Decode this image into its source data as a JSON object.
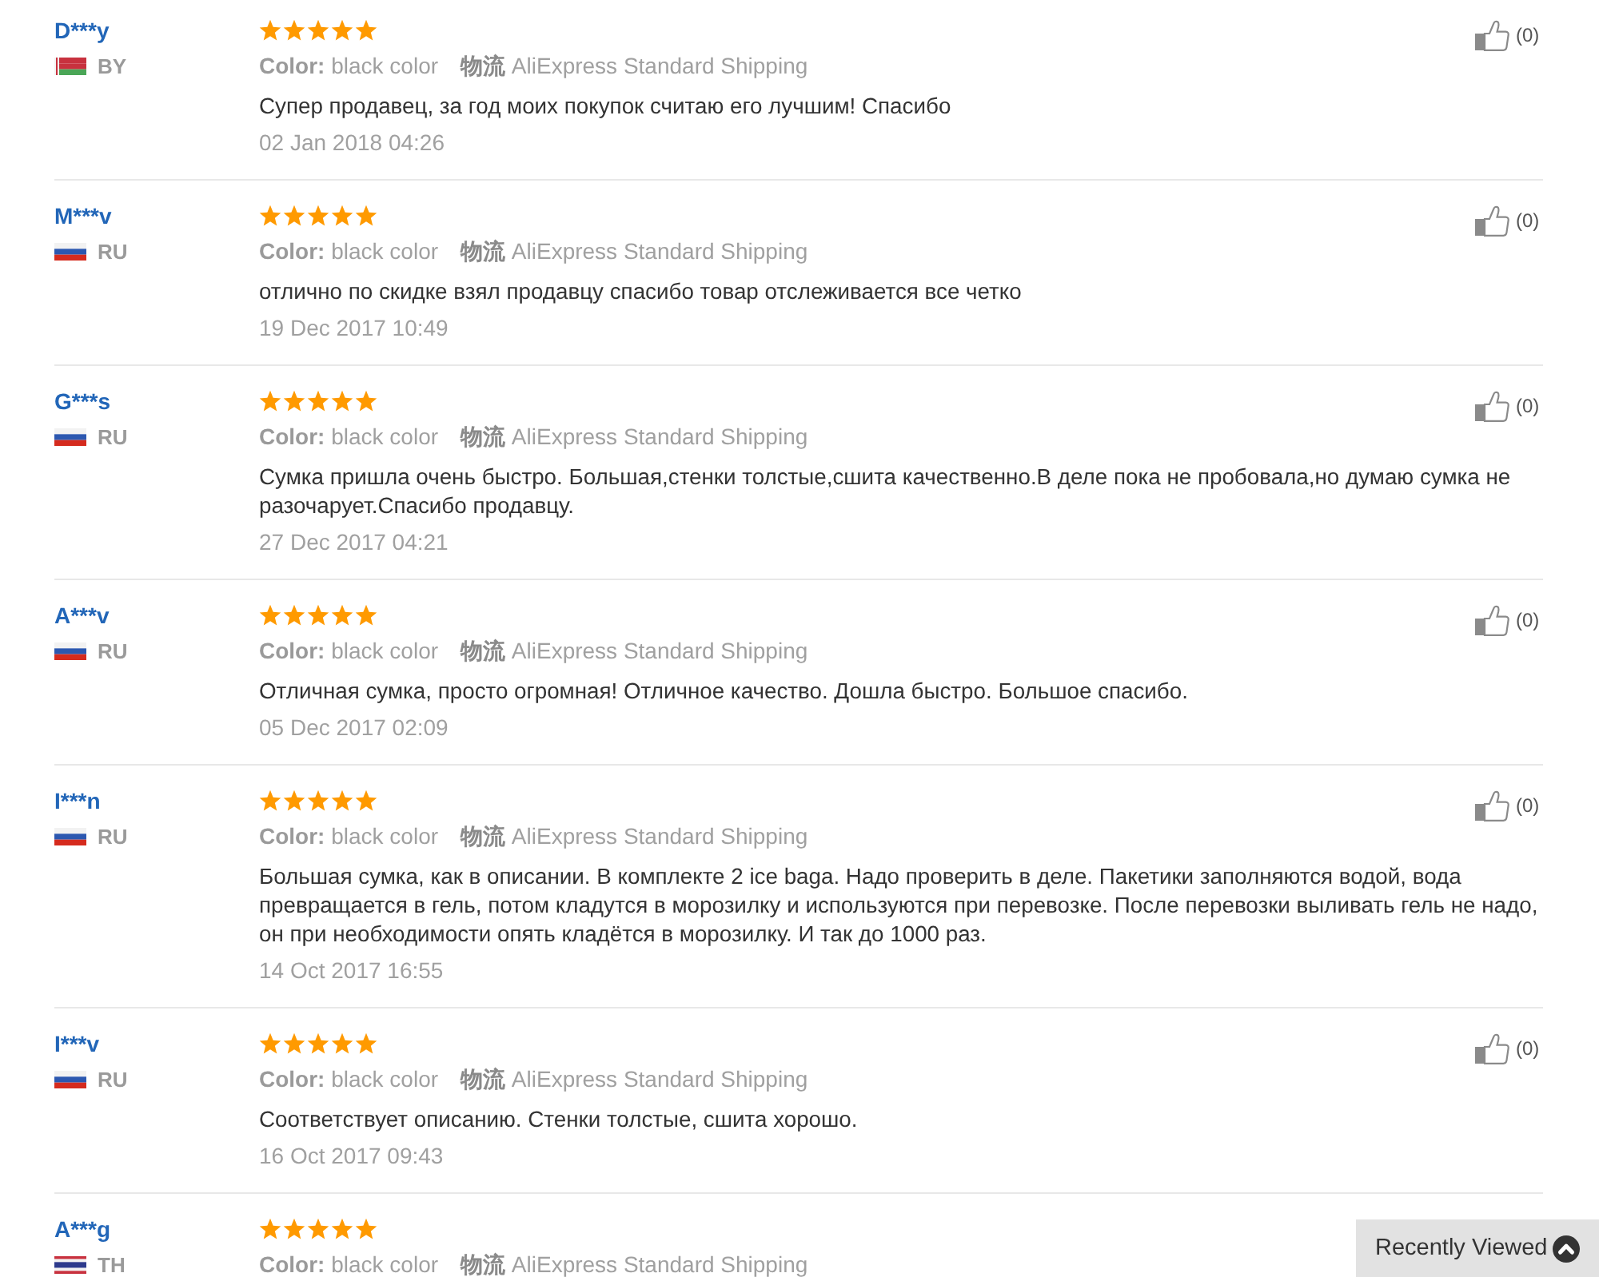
{
  "reviews": [
    {
      "name": "D***y",
      "country": "BY",
      "flag": {
        "kind": "belarus"
      },
      "stars": 5,
      "variant": "**Color:** black color",
      "shipping": "**物流** AliExpress Standard Shipping",
      "text": "Супер продавец, за год моих покупок считаю его лучшим! Спасибо",
      "date": "02 Jan 2018 04:26",
      "likes": "(0)"
    },
    {
      "name": "M***v",
      "country": "RU",
      "flag": {
        "kind": "russia"
      },
      "stars": 5,
      "variant": "**Color:** black color",
      "shipping": "**物流** AliExpress Standard Shipping",
      "text": "отлично по скидке взял продавцу спасибо товар отслеживается все четко",
      "date": "19 Dec 2017 10:49",
      "likes": "(0)"
    },
    {
      "name": "G***s",
      "country": "RU",
      "flag": {
        "kind": "russia"
      },
      "stars": 5,
      "variant": "**Color:** black color",
      "shipping": "**物流** AliExpress Standard Shipping",
      "text": "Сумка пришла очень быстро. Большая,стенки толстые,сшита качественно.В деле пока не пробовала,но думаю сумка не разочарует.Спасибо продавцу.",
      "date": "27 Dec 2017 04:21",
      "likes": "(0)"
    },
    {
      "name": "A***v",
      "country": "RU",
      "flag": {
        "kind": "russia"
      },
      "stars": 5,
      "variant": "**Color:** black color",
      "shipping": "**物流** AliExpress Standard Shipping",
      "text": "Отличная сумка, просто огромная! Отличное качество. Дошла быстро. Большое спасибо.",
      "date": "05 Dec 2017 02:09",
      "likes": "(0)"
    },
    {
      "name": "I***n",
      "country": "RU",
      "flag": {
        "kind": "russia"
      },
      "stars": 5,
      "variant": "**Color:** black color",
      "shipping": "**物流** AliExpress Standard Shipping",
      "text": "Большая сумка, как в описании. В комплекте 2 ice baga. Надо проверить в деле. Пакетики заполняются водой, вода превращается в гель, потом кладутся в морозилку и используются при перевозке. После перевозки выливать гель не надо, он при необходимости опять кладётся в морозилку. И так до 1000 раз.",
      "date": "14 Oct 2017 16:55",
      "likes": "(0)"
    },
    {
      "name": "I***v",
      "country": "RU",
      "flag": {
        "kind": "russia"
      },
      "stars": 5,
      "variant": "**Color:** black color",
      "shipping": "**物流** AliExpress Standard Shipping",
      "text": "Соответствует описанию. Стенки толстые, сшита хорошо.",
      "date": "16 Oct 2017 09:43",
      "likes": "(0)"
    },
    {
      "name": "A***g",
      "country": "TH",
      "flag": {
        "kind": "thailand"
      },
      "stars": 5,
      "variant": "**Color:** black color",
      "shipping": "**物流** AliExpress Standard Shipping"
    }
  ],
  "recently_viewed": {
    "label": "Recently Viewed"
  }
}
